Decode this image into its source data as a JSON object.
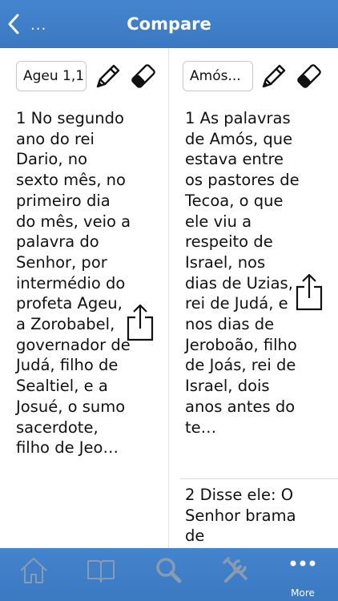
{
  "nav": {
    "back_label": "...",
    "title": "Compare"
  },
  "left_column": {
    "reference": "Ageu 1,1",
    "verse_1": "1 No segundo ano do rei Dario, no sexto mês, no primeiro dia do mês, veio a palavra do Senhor, por intermédio do profeta Ageu, a Zorobabel, governador de Judá, filho de Sealtiel, e a Josué, o sumo sacerdote, filho de Jeo…"
  },
  "right_column": {
    "reference": "Amós...",
    "verse_1": "1 As palavras de Amós, que estava entre os pastores de Tecoa, o que ele viu a respeito de Israel, nos dias de Uzias, rei de Judá, e nos dias de Jeroboão, filho de Joás, rei de Israel, dois anos antes do te…",
    "verse_2": "2 Disse ele: O Senhor brama de"
  },
  "tabbar": {
    "items": [
      {
        "icon": "home-icon",
        "label": ""
      },
      {
        "icon": "book-icon",
        "label": ""
      },
      {
        "icon": "search-icon",
        "label": ""
      },
      {
        "icon": "tools-icon",
        "label": ""
      },
      {
        "icon": "more-icon",
        "label": "More"
      }
    ]
  },
  "colors": {
    "bar_blue": "#3f7fc8",
    "icon_gray": "#8a9bb0",
    "text": "#111111"
  }
}
